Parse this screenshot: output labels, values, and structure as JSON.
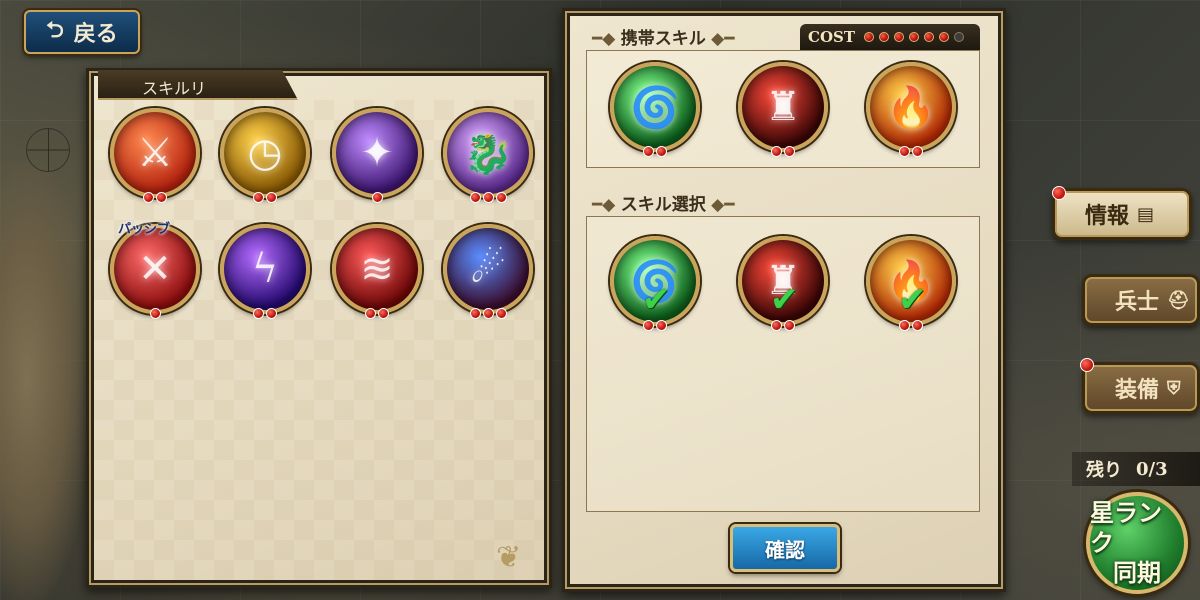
{
  "header": {
    "back_label": "戻る",
    "back_icon": "return-arrow-icon"
  },
  "skill_list": {
    "title": "スキルリ",
    "passive_label": "パッシブ",
    "skills": [
      {
        "name": "sword-slash-red",
        "pips": 2,
        "colors": [
          "#ff8a50",
          "#b3220e"
        ],
        "glyph": "⚔"
      },
      {
        "name": "clock-gold",
        "pips": 2,
        "colors": [
          "#ffd24a",
          "#8a5a05"
        ],
        "glyph": "◷"
      },
      {
        "name": "dark-pillar-purple",
        "pips": 1,
        "colors": [
          "#c08cff",
          "#3d1670"
        ],
        "glyph": "✦"
      },
      {
        "name": "dragon-purple",
        "pips": 3,
        "colors": [
          "#d7a6ff",
          "#5b2a8c"
        ],
        "glyph": "🐉"
      },
      {
        "name": "passive-sword-cross",
        "pips": 1,
        "colors": [
          "#ff6b6b",
          "#8c0e0e"
        ],
        "glyph": "✕"
      },
      {
        "name": "lightning-violet",
        "pips": 2,
        "colors": [
          "#b56bff",
          "#240a6e"
        ],
        "glyph": "ϟ"
      },
      {
        "name": "red-slash",
        "pips": 2,
        "colors": [
          "#ff5a5a",
          "#6e0808"
        ],
        "glyph": "≋"
      },
      {
        "name": "beast-storm-blue",
        "pips": 3,
        "colors": [
          "#5a8cff",
          "#3a0e2e"
        ],
        "glyph": "☄"
      }
    ]
  },
  "carried_skills": {
    "title": "携帯スキル",
    "cost_label": "COST",
    "cost_filled": 6,
    "cost_total": 7,
    "skills": [
      {
        "name": "tornado-green",
        "pips": 2,
        "colors": [
          "#7dff8a",
          "#0d5e1c"
        ],
        "glyph": "🌀"
      },
      {
        "name": "castle-dark-red",
        "pips": 2,
        "colors": [
          "#ff4a3a",
          "#3a0606"
        ],
        "glyph": "♜"
      },
      {
        "name": "fire-blast",
        "pips": 2,
        "colors": [
          "#ffd24a",
          "#b32a05"
        ],
        "glyph": "🔥"
      }
    ]
  },
  "skill_selection": {
    "title": "スキル選択",
    "skills": [
      {
        "name": "tornado-green",
        "pips": 2,
        "colors": [
          "#7dff8a",
          "#0d5e1c"
        ],
        "glyph": "🌀",
        "check": "✔"
      },
      {
        "name": "castle-dark-red",
        "pips": 2,
        "colors": [
          "#ff4a3a",
          "#3a0606"
        ],
        "glyph": "♜",
        "check": "✔"
      },
      {
        "name": "fire-blast",
        "pips": 2,
        "colors": [
          "#ffd24a",
          "#b32a05"
        ],
        "glyph": "🔥",
        "check": "✔"
      }
    ]
  },
  "confirm_label": "確認",
  "side_menu": {
    "info": {
      "label": "情報",
      "icon": "book-icon"
    },
    "soldiers": {
      "label": "兵士",
      "icon": "helmet-icon"
    },
    "equipment": {
      "label": "装備",
      "icon": "shield-icon"
    }
  },
  "remaining": {
    "label": "残り",
    "value": "0/3"
  },
  "star_sync": {
    "line1": "星ランク",
    "line2": "同期"
  }
}
